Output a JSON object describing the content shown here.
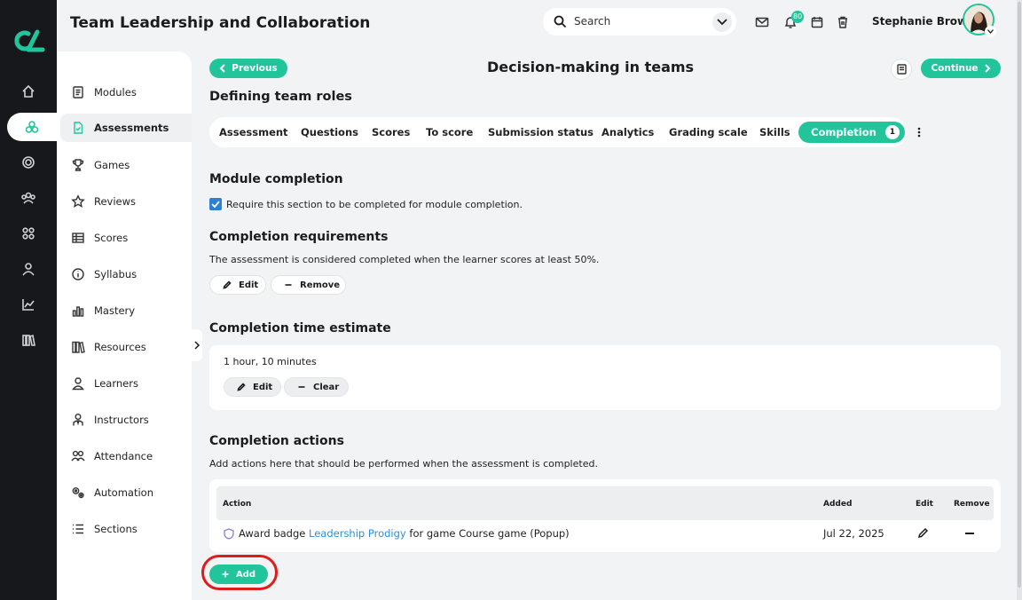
{
  "app": {
    "course_title": "Team Leadership and Collaboration",
    "brand_color": "#22c49b"
  },
  "rail": {
    "logo": "course-logo",
    "items": [
      {
        "icon": "home-icon"
      },
      {
        "icon": "courses-icon",
        "active": true
      },
      {
        "icon": "target-icon"
      },
      {
        "icon": "groups-icon"
      },
      {
        "icon": "apps-icon"
      },
      {
        "icon": "profile-icon"
      },
      {
        "icon": "analytics-icon"
      },
      {
        "icon": "library-icon"
      }
    ]
  },
  "header": {
    "search_placeholder": "Search",
    "notification_count": "80",
    "user_name": "Stephanie Brown"
  },
  "sidebar": {
    "items": [
      {
        "label": "Modules",
        "icon": "modules-icon"
      },
      {
        "label": "Assessments",
        "icon": "assessments-icon",
        "active": true
      },
      {
        "label": "Games",
        "icon": "trophy-icon"
      },
      {
        "label": "Reviews",
        "icon": "star-icon"
      },
      {
        "label": "Scores",
        "icon": "table-icon"
      },
      {
        "label": "Syllabus",
        "icon": "info-icon"
      },
      {
        "label": "Mastery",
        "icon": "bar-chart-icon"
      },
      {
        "label": "Resources",
        "icon": "books-icon"
      },
      {
        "label": "Learners",
        "icon": "person-icon"
      },
      {
        "label": "Instructors",
        "icon": "instructor-icon"
      },
      {
        "label": "Attendance",
        "icon": "attendance-icon"
      },
      {
        "label": "Automation",
        "icon": "gears-icon"
      },
      {
        "label": "Sections",
        "icon": "list-icon"
      }
    ]
  },
  "nav": {
    "previous": "Previous",
    "continue": "Continue",
    "page_title": "Decision-making in teams",
    "section_title": "Defining team roles"
  },
  "tabs": [
    {
      "label": "Assessment"
    },
    {
      "label": "Questions"
    },
    {
      "label": "Scores"
    },
    {
      "label": "To score"
    },
    {
      "label": "Submission status"
    },
    {
      "label": "Analytics"
    },
    {
      "label": "Grading scale"
    },
    {
      "label": "Skills"
    },
    {
      "label": "Completion",
      "count": "1",
      "active": true
    }
  ],
  "module_completion": {
    "heading": "Module completion",
    "checkbox_label": "Require this section to be completed for module completion.",
    "checked": true
  },
  "requirements": {
    "heading": "Completion requirements",
    "text": "The assessment is considered completed when the learner scores at least 50%.",
    "edit": "Edit",
    "remove": "Remove"
  },
  "time_estimate": {
    "heading": "Completion time estimate",
    "value": "1 hour, 10 minutes",
    "edit": "Edit",
    "clear": "Clear"
  },
  "actions": {
    "heading": "Completion actions",
    "description": "Add actions here that should be performed when the assessment is completed.",
    "columns": {
      "action": "Action",
      "added": "Added",
      "edit": "Edit",
      "remove": "Remove"
    },
    "rows": [
      {
        "prefix": "Award badge ",
        "badge": "Leadership Prodigy",
        "suffix": " for game Course game (Popup)",
        "added": "Jul 22, 2025"
      }
    ],
    "add": "Add"
  }
}
